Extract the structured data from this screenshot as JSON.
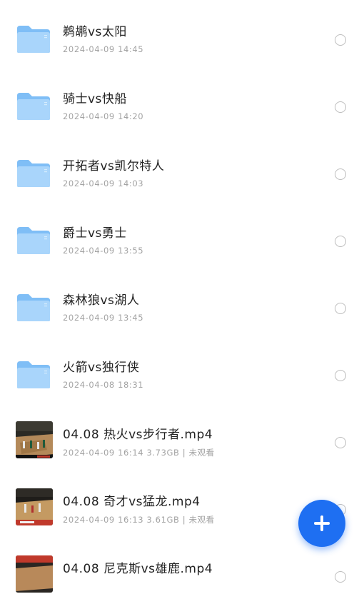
{
  "items": [
    {
      "type": "folder",
      "title": "鹈鹕vs太阳",
      "meta": "2024-04-09 14:45"
    },
    {
      "type": "folder",
      "title": "骑士vs快船",
      "meta": "2024-04-09 14:20"
    },
    {
      "type": "folder",
      "title": "开拓者vs凯尔特人",
      "meta": "2024-04-09 14:03"
    },
    {
      "type": "folder",
      "title": "爵士vs勇士",
      "meta": "2024-04-09 13:55"
    },
    {
      "type": "folder",
      "title": "森林狼vs湖人",
      "meta": "2024-04-09 13:45"
    },
    {
      "type": "folder",
      "title": "火箭vs独行侠",
      "meta": "2024-04-08 18:31"
    },
    {
      "type": "video",
      "title": "04.08 热火vs步行者.mp4",
      "meta": "2024-04-09 16:14 3.73GB | 未观看"
    },
    {
      "type": "video",
      "title": "04.08 奇才vs猛龙.mp4",
      "meta": "2024-04-09 16:13 3.61GB | 未观看"
    },
    {
      "type": "video",
      "title": "04.08 尼克斯vs雄鹿.mp4",
      "meta": ""
    }
  ],
  "icons": {
    "folder": "folder-icon",
    "video": "video-thumbnail",
    "fab": "plus-icon"
  },
  "colors": {
    "accent": "#1e6ff2",
    "folder": "#8cc5f7",
    "title": "#222222",
    "meta": "#a3a3a3"
  }
}
